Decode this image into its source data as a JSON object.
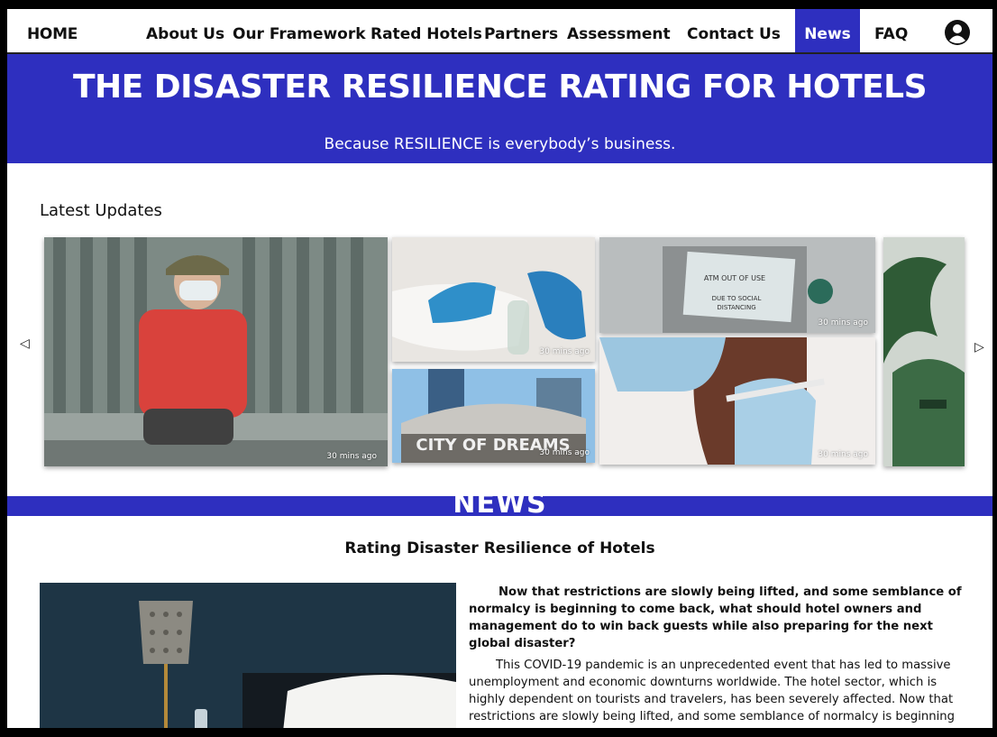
{
  "nav": {
    "home": "HOME",
    "items": [
      "About Us",
      "Our Framework",
      "Rated Hotels",
      "Partners",
      "Assessment",
      "Contact Us",
      "News",
      "FAQ"
    ],
    "active": "News",
    "account_icon": "user-circle-icon"
  },
  "hero": {
    "title": "THE DISASTER RESILIENCE RATING FOR HOTELS",
    "subtitle": "Because RESILIENCE is everybody’s business."
  },
  "updates": {
    "heading": "Latest Updates",
    "prev_icon": "triangle-left-icon",
    "next_icon": "triangle-right-icon",
    "cards": [
      {
        "time": "30 mins ago",
        "subject": "man-wearing-face-mask"
      },
      {
        "time": "30 mins ago",
        "subject": "gloved-hand-disinfecting"
      },
      {
        "time": "30 mins ago",
        "subject": "city-of-dreams-building"
      },
      {
        "time": "30 mins ago",
        "subject": "atm-out-of-use"
      },
      {
        "time": "30 mins ago",
        "subject": "vaccine-injection"
      }
    ],
    "atm_sign": [
      "ATM OUT OF USE",
      "DUE TO SOCIAL",
      "DISTANCING"
    ],
    "building_sign": "CITY OF DREAMS"
  },
  "news": {
    "band_label": "NEWS",
    "article_title": "Rating Disaster Resilience of Hotels",
    "lead": "Now that restrictions are slowly being lifted, and some semblance of normalcy is beginning to come back, what should hotel owners and management do to win back guests while also preparing for the next global disaster?",
    "body": "This COVID-19 pandemic is an unprecedented event that has led to massive unemployment and economic downturns worldwide. The hotel sector, which is highly dependent on tourists and travelers, has been severely affected. Now that restrictions are slowly being lifted, and some semblance of normalcy is beginning to come back."
  },
  "colors": {
    "brand_blue": "#2e2fbf",
    "page_bg": "#ffffff"
  }
}
